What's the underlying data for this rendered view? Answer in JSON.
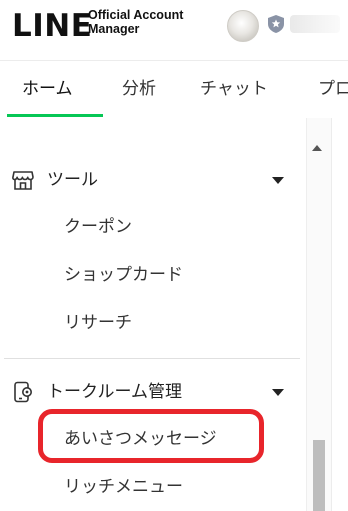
{
  "header": {
    "logo_main": "LINE",
    "logo_sub_line1": "Official Account",
    "logo_sub_line2": "Manager",
    "accent_color": "#06c755"
  },
  "tabs": [
    {
      "label": "ホーム",
      "active": true
    },
    {
      "label": "分析",
      "active": false
    },
    {
      "label": "チャット",
      "active": false
    },
    {
      "label": "プロ",
      "active": false
    }
  ],
  "sidebar": {
    "sections": [
      {
        "label": "ツール",
        "icon": "store-icon",
        "items": [
          "クーポン",
          "ショップカード",
          "リサーチ"
        ]
      },
      {
        "label": "トークルーム管理",
        "icon": "chat-settings-icon",
        "items": [
          "あいさつメッセージ",
          "リッチメニュー"
        ]
      }
    ],
    "highlighted_item": "あいさつメッセージ",
    "highlight_color": "#e8252b"
  }
}
